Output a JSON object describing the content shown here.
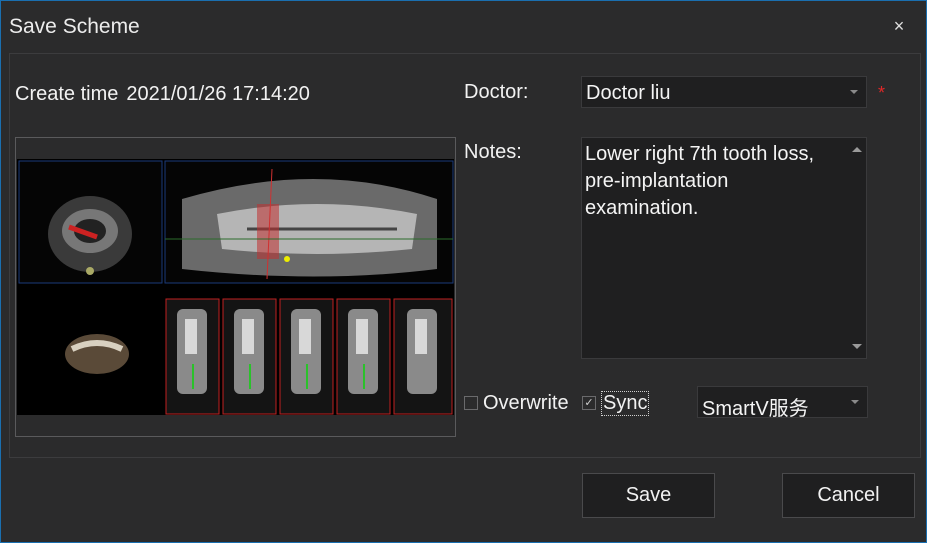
{
  "window": {
    "title": "Save Scheme"
  },
  "create_time": {
    "label": "Create time",
    "value": "2021/01/26 17:14:20"
  },
  "form": {
    "doctor_label": "Doctor:",
    "doctor_value": "Doctor liu",
    "required_mark": "*",
    "notes_label": "Notes:",
    "notes_value": "Lower right 7th tooth loss,\npre-implantation\nexamination."
  },
  "options": {
    "overwrite_label": "Overwrite",
    "overwrite_checked": false,
    "sync_label": "Sync",
    "sync_checked": true,
    "check_mark": "✓",
    "service_value": "SmartV服务"
  },
  "buttons": {
    "save": "Save",
    "cancel": "Cancel"
  },
  "icons": {
    "close": "×"
  }
}
